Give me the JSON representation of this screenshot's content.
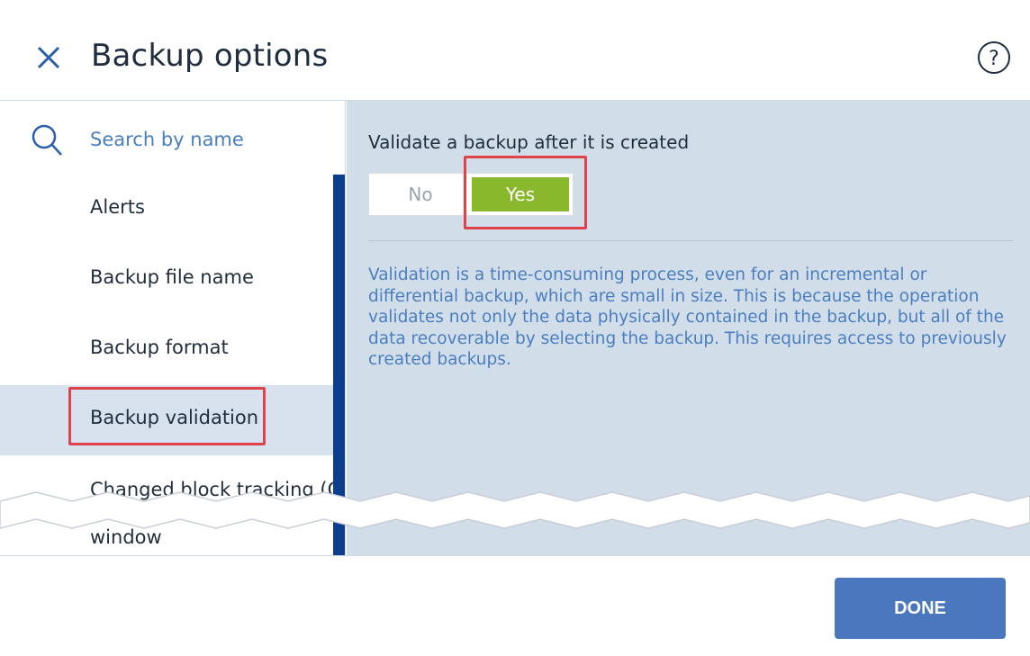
{
  "header": {
    "title": "Backup options",
    "close_icon": "close-icon",
    "help_icon": "help-icon",
    "help_glyph": "?"
  },
  "sidebar": {
    "search": {
      "placeholder": "Search by name",
      "icon": "search-icon"
    },
    "items": [
      {
        "label": "Alerts",
        "selected": false
      },
      {
        "label": "Backup file name",
        "selected": false
      },
      {
        "label": "Backup format",
        "selected": false
      },
      {
        "label": "Backup validation",
        "selected": true
      },
      {
        "label": "Changed block tracking (CBT)",
        "selected": false
      },
      {
        "label": "window",
        "selected": false
      }
    ]
  },
  "content": {
    "setting_label": "Validate a backup after it is created",
    "toggle": {
      "no_label": "No",
      "yes_label": "Yes",
      "value": "Yes"
    },
    "description": "Validation is a time-consuming process, even for an incremental or differential backup, which are small in size. This is because the operation validates not only the data physically contained in the backup, but all of the data recoverable by selecting the backup. This requires access to previously created backups."
  },
  "footer": {
    "done_label": "DONE"
  },
  "colors": {
    "accent_blue": "#4a77bd",
    "link_blue": "#4a7fbf",
    "toggle_green": "#8ab82c",
    "highlight_red": "#e0424a",
    "panel_bg": "#d2ddea",
    "scrollbar": "#0c3e8e"
  }
}
